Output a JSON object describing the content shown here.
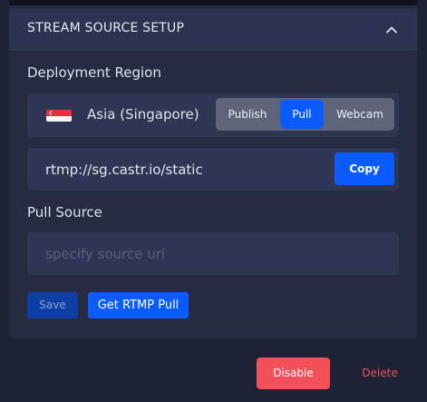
{
  "section": {
    "title": "STREAM SOURCE SETUP",
    "collapse_icon": "chevron-up-icon"
  },
  "region": {
    "label": "Deployment Region",
    "name": "Asia (Singapore)",
    "flag_icon": "singapore-flag-icon"
  },
  "modes": [
    {
      "label": "Publish",
      "active": false
    },
    {
      "label": "Pull",
      "active": true
    },
    {
      "label": "Webcam",
      "active": false
    }
  ],
  "url": {
    "value": "rtmp://sg.castr.io/static",
    "copy_label": "Copy"
  },
  "pull_source": {
    "label": "Pull Source",
    "placeholder": "specify source url",
    "value": ""
  },
  "actions": {
    "save_label": "Save",
    "get_pull_label": "Get RTMP Pull"
  },
  "footer": {
    "disable_label": "Disable",
    "delete_label": "Delete"
  },
  "colors": {
    "accent": "#0a5cff",
    "danger": "#f4505a",
    "background": "#1d2235",
    "panel": "#252b41",
    "field": "#2f3653"
  }
}
